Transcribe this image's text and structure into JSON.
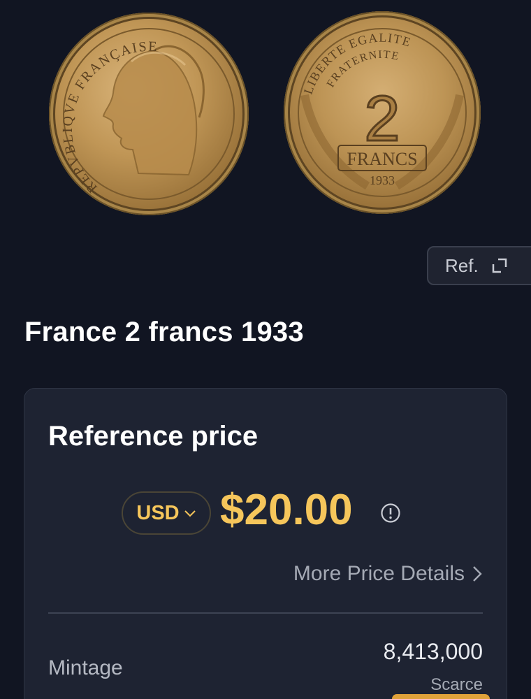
{
  "coin_images": {
    "obverse": {
      "alt": "Obverse",
      "legend": "REPVBLIQVE FRANÇAISE"
    },
    "reverse": {
      "alt": "Reverse",
      "legend_top": "LIBERTE EGALITE",
      "legend_mid": "FRATERNITE",
      "denomination": "2",
      "unit": "FRANCS",
      "year": "1933"
    }
  },
  "ref_button": {
    "label": "Ref.",
    "icon": "expand-icon"
  },
  "coin_title": "France 2 francs 1933",
  "price_card": {
    "heading": "Reference price",
    "currency": {
      "selected": "USD",
      "icon": "chevron-down-icon"
    },
    "price": "$20.00",
    "info_icon": "info-icon",
    "more_details": {
      "label": "More Price Details",
      "icon": "chevron-right-icon"
    },
    "mintage": {
      "label": "Mintage",
      "value": "8,413,000",
      "note": "Scarce"
    }
  },
  "colors": {
    "background": "#111522",
    "card": "#1e2332",
    "accent": "#f6c65b",
    "rarity": "#e0a23a"
  }
}
